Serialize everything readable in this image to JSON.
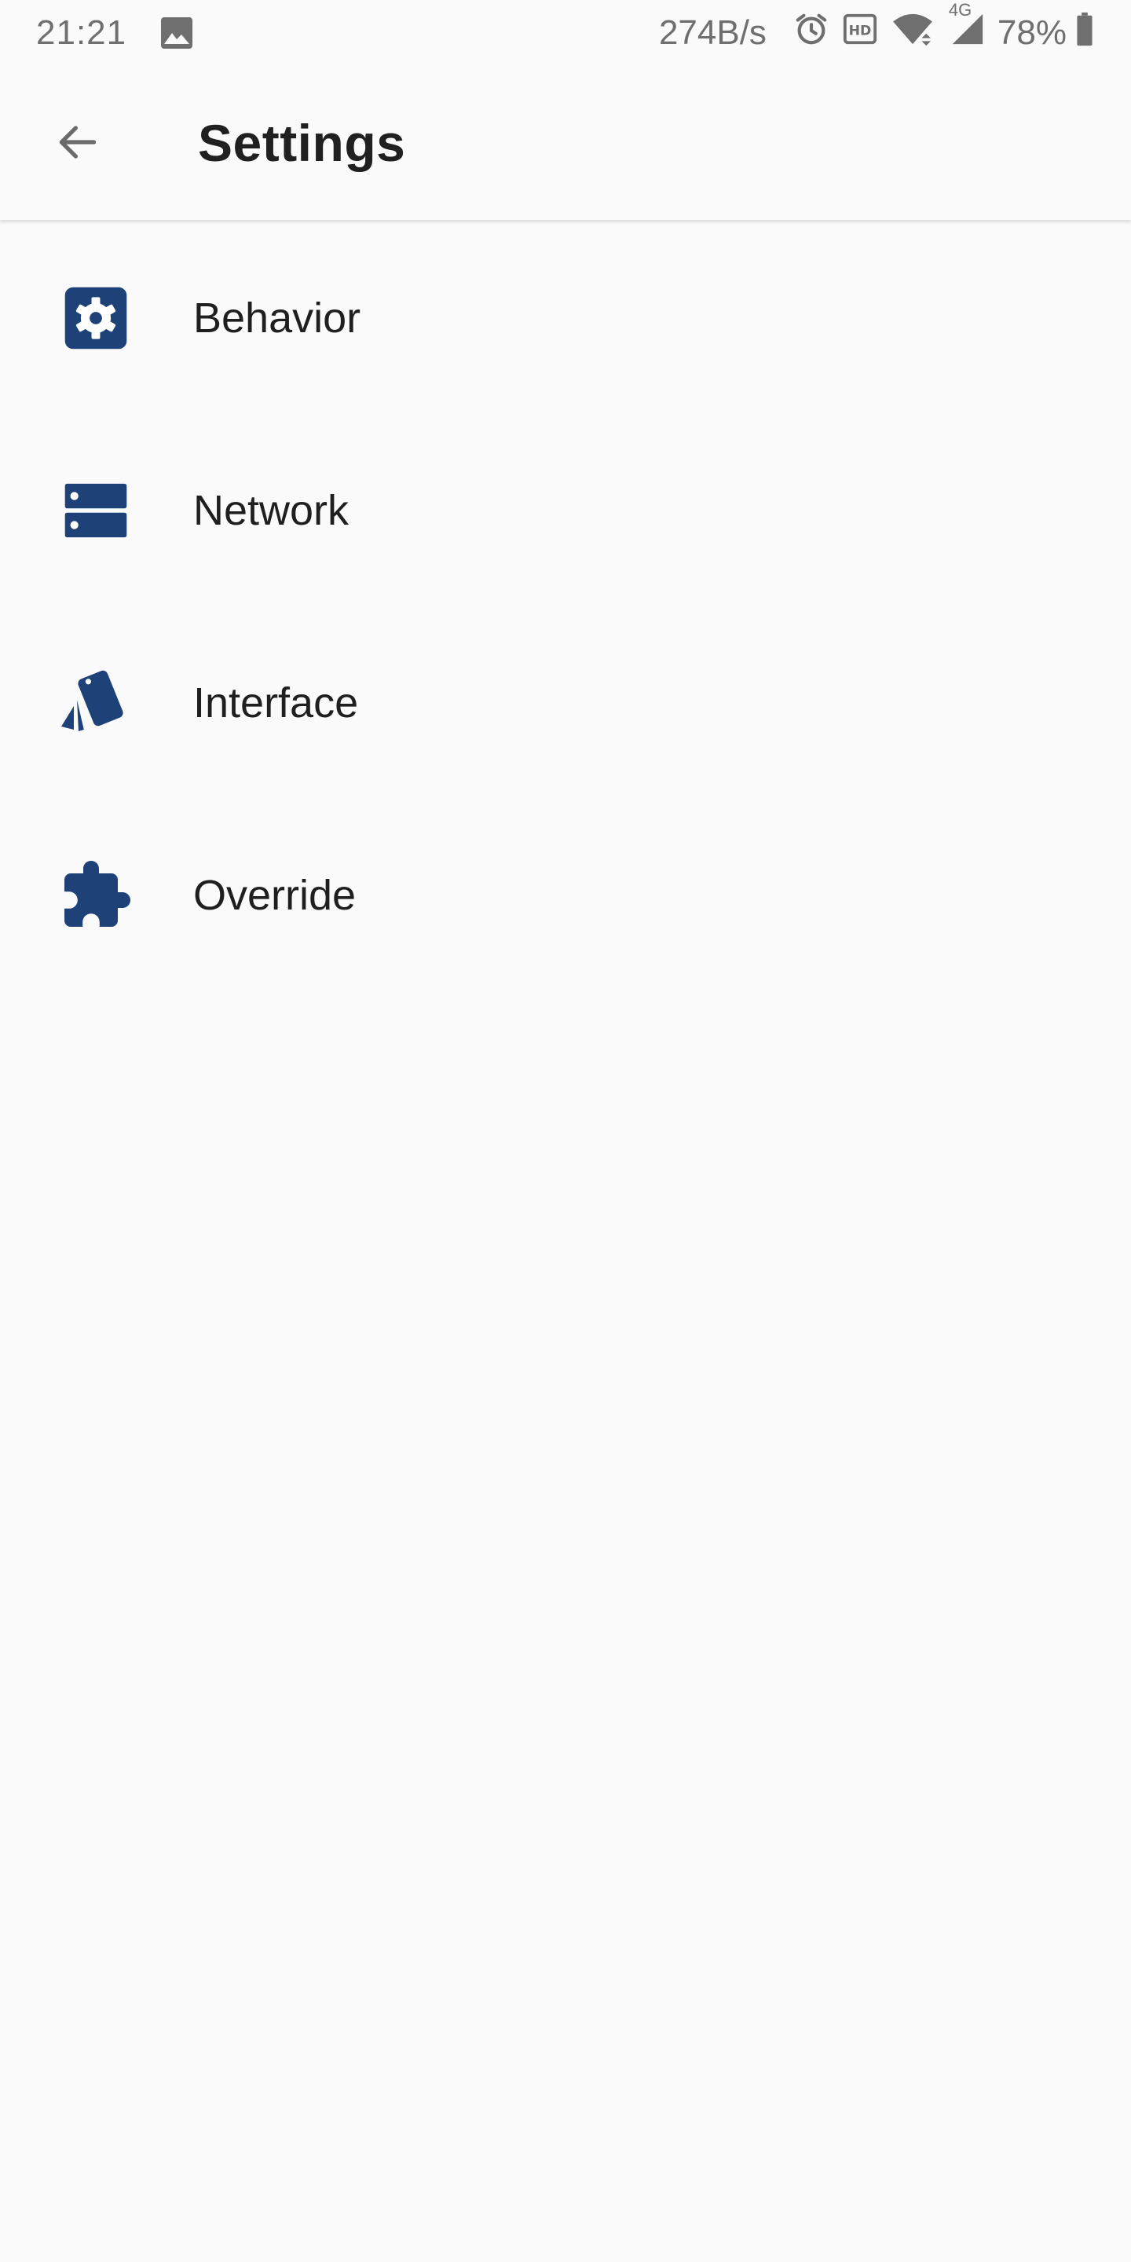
{
  "status_bar": {
    "time": "21:21",
    "net_speed": "274B/s",
    "network_type": "4G",
    "battery": "78%",
    "icons": [
      "image-icon",
      "alarm-icon",
      "hd-icon",
      "wifi-icon",
      "signal-icon",
      "battery-icon"
    ]
  },
  "app_bar": {
    "title": "Settings",
    "back_icon": "arrow-back-icon"
  },
  "colors": {
    "icon_blue": "#1e4178",
    "background": "#fafafa",
    "text": "#1f1f1f",
    "status_text": "#6f6f6f"
  },
  "settings": {
    "items": [
      {
        "label": "Behavior",
        "icon": "gear-square-icon"
      },
      {
        "label": "Network",
        "icon": "server-icon"
      },
      {
        "label": "Interface",
        "icon": "cards-icon"
      },
      {
        "label": "Override",
        "icon": "puzzle-icon"
      }
    ]
  }
}
